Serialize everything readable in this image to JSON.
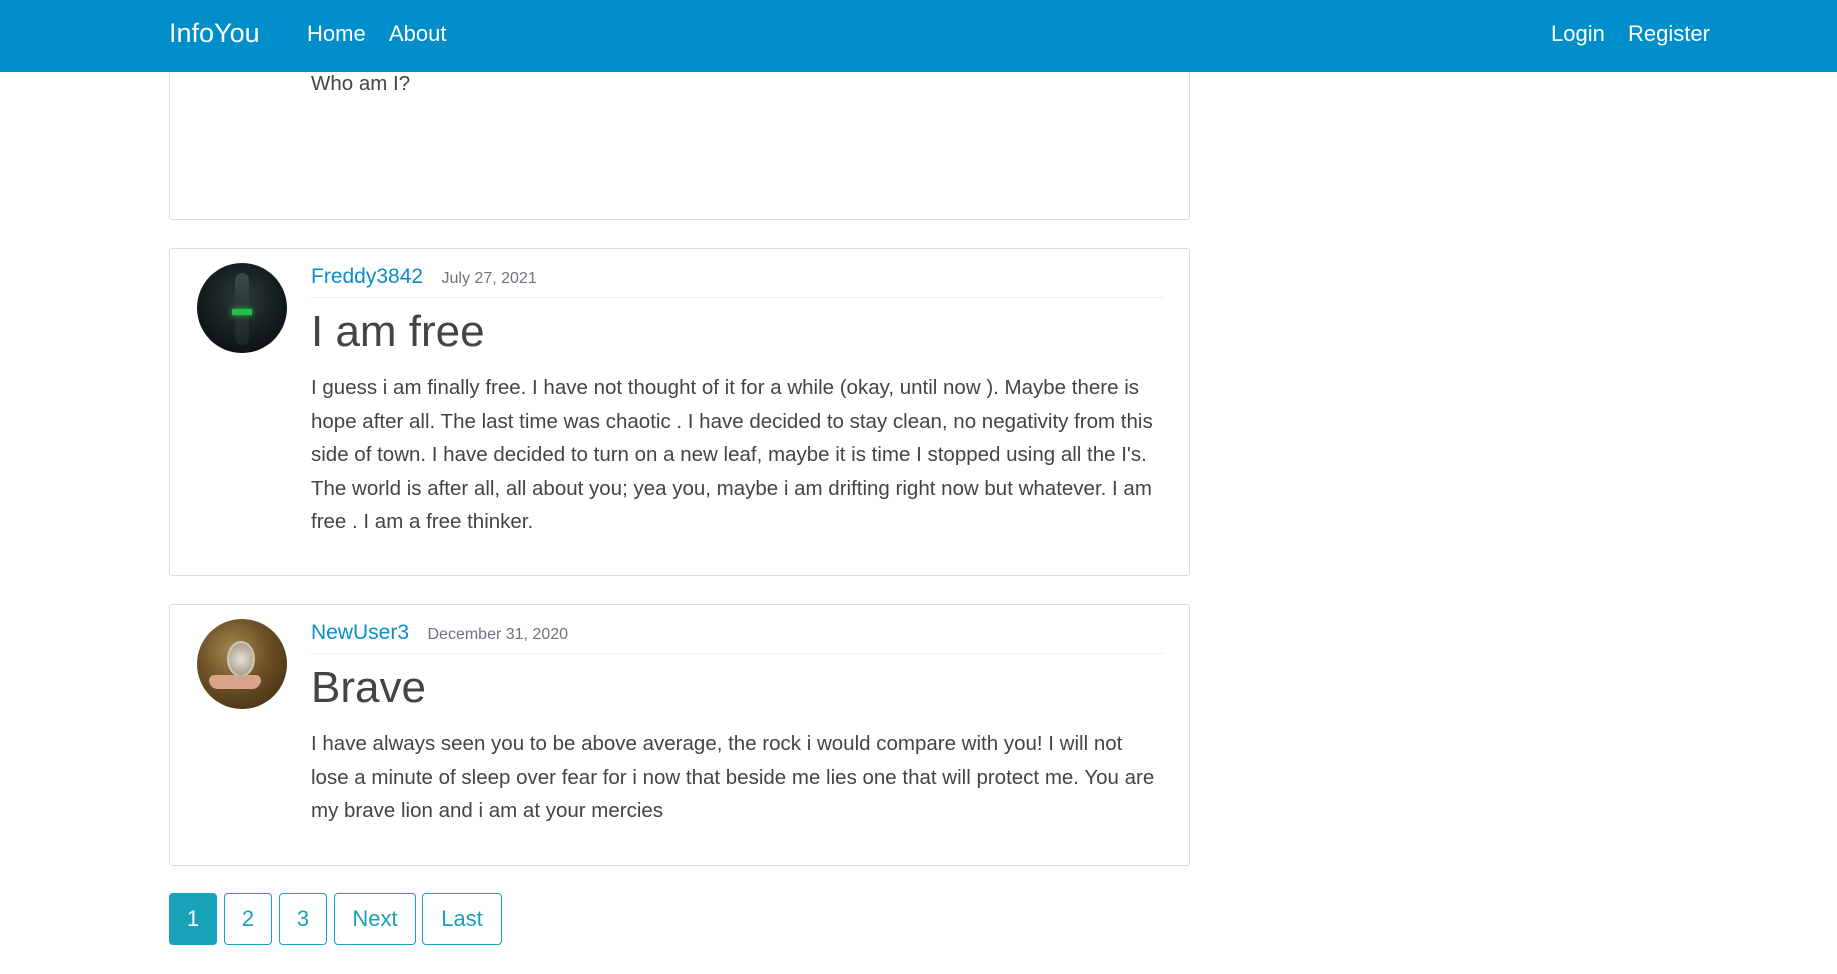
{
  "navbar": {
    "brand": "InfoYou",
    "left_links": [
      "Home",
      "About"
    ],
    "right_links": [
      "Login",
      "Register"
    ],
    "background_color": "#008ecb"
  },
  "posts": [
    {
      "text": "good feeling. Oh wait, he is real but i don't know me or rather the real me . Yes, the real me.\nWho am I?"
    },
    {
      "author": "Freddy3842",
      "date": "July 27, 2021",
      "title": "I am free",
      "avatar_icon": "dark-silhouette-avatar",
      "text": "I guess i am finally free. I have not thought of it for a while (okay, until now ). Maybe there is hope after all. The last time was chaotic . I have decided to stay clean, no negativity from this side of town. I have decided to turn on a new leaf, maybe it is time I stopped using all the I's. The world is after all, all about you; yea you, maybe i am drifting right now but whatever. I am free . I am a free thinker."
    },
    {
      "author": "NewUser3",
      "date": "December 31, 2020",
      "title": "Brave",
      "avatar_icon": "hand-holding-clock-avatar",
      "text": "I have always seen you to be above average, the rock i would compare with you! I will not lose a minute of sleep over fear for i now that beside me lies one that will protect me. You are my brave lion and i am at your mercies"
    }
  ],
  "pagination": {
    "pages": [
      "1",
      "2",
      "3"
    ],
    "active_page": "1",
    "next_label": "Next",
    "last_label": "Last",
    "accent_color": "#17a2b8"
  },
  "colors": {
    "author_link": "#0b8ec8",
    "date_text": "#6c757d",
    "body_text": "#444444"
  }
}
